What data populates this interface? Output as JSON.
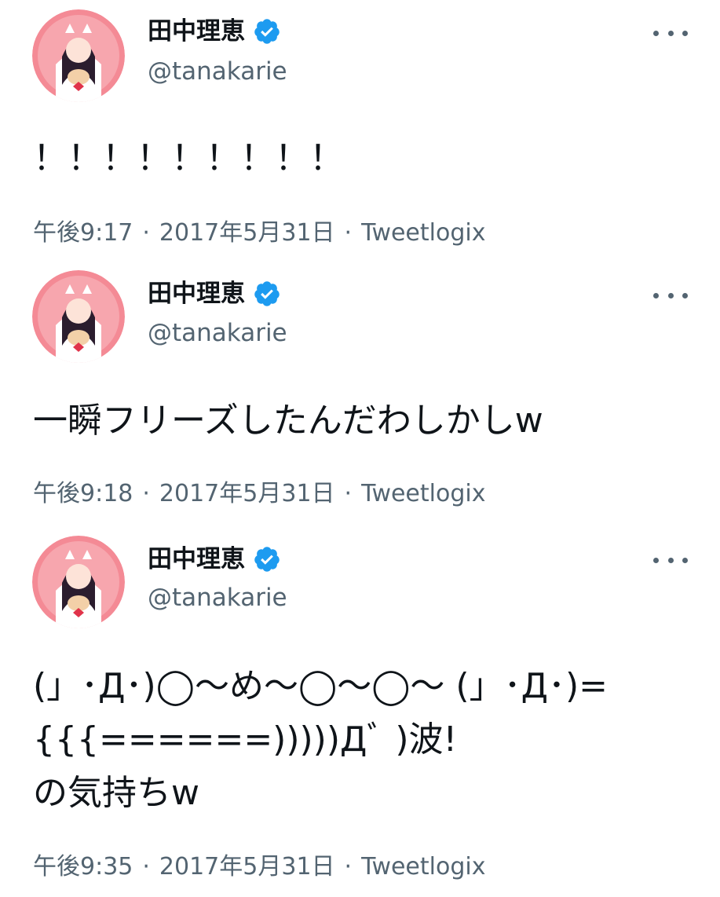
{
  "tweets": [
    {
      "display_name": "田中理恵",
      "handle": "@tanakarie",
      "text": "！！！！！！！！！",
      "time": "午後9:17",
      "date": "2017年5月31日",
      "client": "Tweetlogix",
      "separator": "·"
    },
    {
      "display_name": "田中理恵",
      "handle": "@tanakarie",
      "text": "一瞬フリーズしたんだわしかしw",
      "time": "午後9:18",
      "date": "2017年5月31日",
      "client": "Tweetlogix",
      "separator": "·"
    },
    {
      "display_name": "田中理恵",
      "handle": "@tanakarie",
      "text": "(」･Д･)◯〜め〜◯〜◯〜 (」･Д･)=\n{{{======)))))Дﾞ )波!\nの気持ちw",
      "time": "午後9:35",
      "date": "2017年5月31日",
      "client": "Tweetlogix",
      "separator": "·"
    }
  ],
  "colors": {
    "verified": "#1d9bf0",
    "secondary_text": "#536471",
    "primary_text": "#0f1419",
    "avatar_bg": "#f48a95"
  },
  "icons": {
    "verified": "verified-badge-icon",
    "more": "more-dots-icon"
  }
}
